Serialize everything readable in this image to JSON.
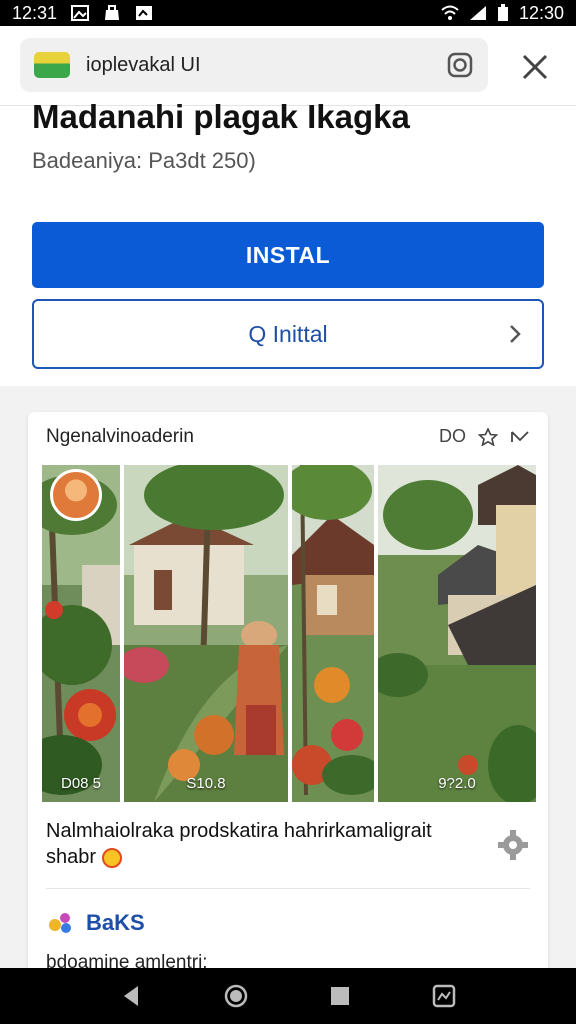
{
  "status_bar": {
    "time_left": "12:31",
    "time_right": "12:30",
    "icons": [
      "image-icon",
      "bag-icon",
      "photo-icon",
      "wifi-icon",
      "signal-icon",
      "battery-icon"
    ]
  },
  "url_bar": {
    "text": "ioplevakal UI",
    "site_icon": "site-logo",
    "action_icon": "instagram-icon",
    "close_icon": "close-icon"
  },
  "app": {
    "title": "Madanahi plagak Ikagka",
    "subtitle": "Badeaniya: Pa3dt 250)"
  },
  "buttons": {
    "primary_label": "INSTAL",
    "secondary_label": "Q Inittal"
  },
  "card": {
    "header": "Ngenalvinoaderin",
    "header_actions_text": "DO",
    "photos": [
      {
        "label": "D08 5"
      },
      {
        "label": "S10.8"
      },
      {
        "label": ""
      },
      {
        "label": "9?2.0"
      }
    ],
    "caption": "Nalmhaiolraka prodskatira hahrirkamaligrait shabr",
    "brand_label": "BaKS",
    "footer_text": "bdoamine amlentri:"
  },
  "colors": {
    "primary": "#0b5bd6",
    "secondary_border": "#1d56b8",
    "background": "#f2f2f2"
  }
}
